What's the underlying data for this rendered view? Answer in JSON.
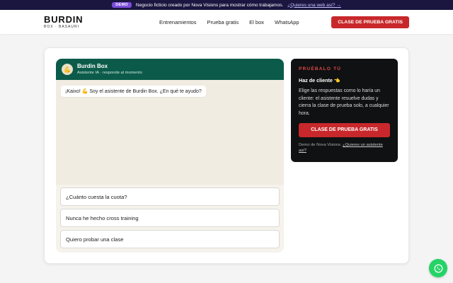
{
  "promo": {
    "badge": "DEMO",
    "text": "Negocio ficticio creado por Nova Visions para mostrar cómo trabajamos.",
    "link": "¿Quieres una web así? →"
  },
  "nav": {
    "logo": "BURDIN",
    "logo_sub": "BOX · BASAURI",
    "links": [
      "Entrenamientos",
      "Prueba gratis",
      "El box",
      "WhatsApp"
    ],
    "cta": "CLASE DE PRUEBA GRATIS"
  },
  "chat": {
    "avatar": "💪",
    "title": "Burdin Box",
    "subtitle": "Asistente IA · responde al momento",
    "message": "¡Kaixo! 💪 Soy el asistente de Burdin Box. ¿En qué te ayudo?",
    "options": [
      "¿Cuánto cuesta la cuota?",
      "Nunca he hecho cross training",
      "Quiero probar una clase"
    ]
  },
  "side": {
    "eyebrow": "PRUÉBALO TÚ",
    "title": "Haz de cliente 👈",
    "text": "Elige las respuestas como lo haría un cliente: el asistente resuelve dudas y cierra la clase de prueba solo, a cualquier hora.",
    "button": "CLASE DE PRUEBA GRATIS",
    "foot_text": "Demo de Nova Visions.",
    "foot_link": "¿Quieres un asistente así?"
  },
  "colors": {
    "brand_red": "#c8282b",
    "chat_header": "#0c5b4a",
    "promo_bg": "#1b1640",
    "whatsapp": "#25d366"
  },
  "icons": {
    "whatsapp": "whatsapp-icon"
  }
}
